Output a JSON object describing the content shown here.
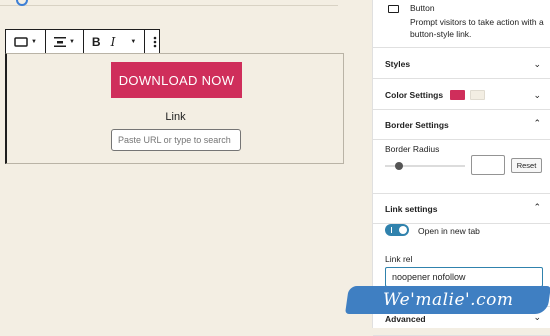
{
  "toolbar": {
    "block_type_icon": "button-block-icon",
    "align_icon": "align-center-icon",
    "bold_label": "B",
    "italic_label": "I",
    "more_icon": "more-vertical-icon"
  },
  "block": {
    "button_text": "DOWNLOAD NOW",
    "button_color": "#cf2e5b",
    "link_label": "Link",
    "link_placeholder": "Paste URL or type to search"
  },
  "sidebar": {
    "style_title": "Button",
    "style_desc": "Prompt visitors to take action with a button-style link.",
    "panels": {
      "styles": "Styles",
      "color": "Color Settings",
      "border": "Border Settings",
      "link": "Link settings",
      "advanced": "Advanced"
    },
    "color_swatches": [
      "#cf2e5b",
      "#f3eee3"
    ],
    "border_radius_label": "Border Radius",
    "reset_label": "Reset",
    "toggle_label": "Open in new tab",
    "link_rel_label": "Link rel",
    "link_rel_value": "noopener nofollow"
  },
  "watermark": "We'malie'.com"
}
